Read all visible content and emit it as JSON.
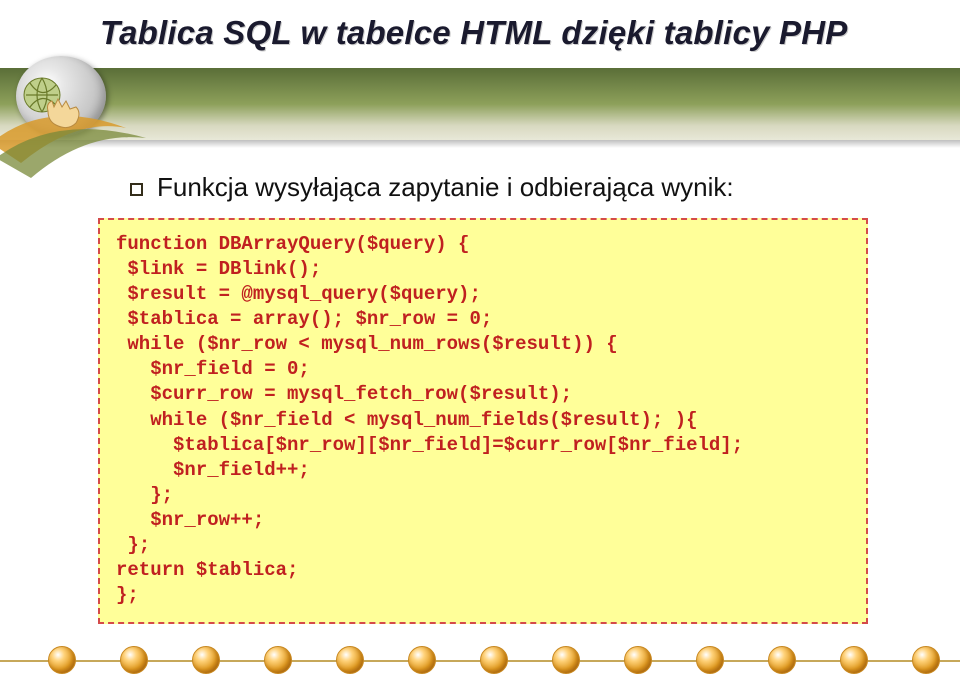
{
  "slide": {
    "title": "Tablica SQL w tabelce HTML dzięki tablicy PHP",
    "bullet": "Funkcja wysyłająca zapytanie i odbierająca wynik:"
  },
  "code": {
    "lines": [
      "function DBArrayQuery($query) {",
      " $link = DBlink();",
      " $result = @mysql_query($query);",
      " $tablica = array(); $nr_row = 0;",
      " while ($nr_row < mysql_num_rows($result)) {",
      "   $nr_field = 0;",
      "   $curr_row = mysql_fetch_row($result);",
      "   while ($nr_field < mysql_num_fields($result); ){",
      "     $tablica[$nr_row][$nr_field]=$curr_row[$nr_field];",
      "     $nr_field++;",
      "   };",
      "   $nr_row++;",
      " };",
      "return $tablica;",
      "};"
    ]
  }
}
